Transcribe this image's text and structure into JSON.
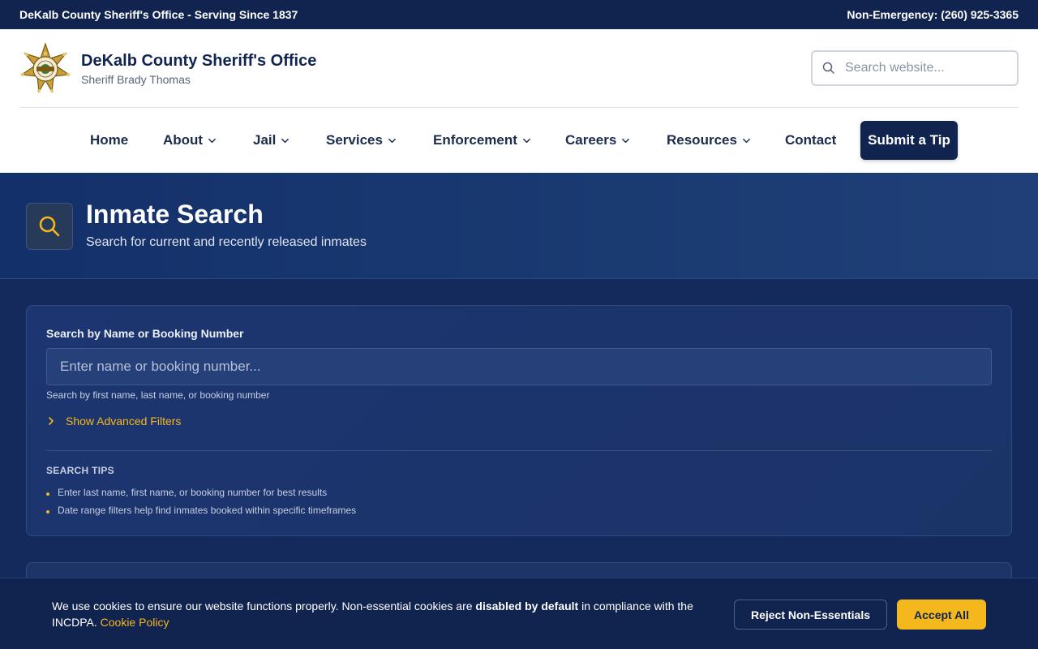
{
  "topbar": {
    "left_text": "DeKalb County Sheriff's Office - Serving Since 1837",
    "right_text": "Non-Emergency: (260) 925-3365"
  },
  "header": {
    "title": "DeKalb County Sheriff's Office",
    "subtitle": "Sheriff Brady Thomas",
    "badge_icon": "sheriff-star-badge",
    "search_placeholder": "Search website..."
  },
  "nav": {
    "items": [
      {
        "label": "Home",
        "dropdown": false
      },
      {
        "label": "About",
        "dropdown": true
      },
      {
        "label": "Jail",
        "dropdown": true
      },
      {
        "label": "Services",
        "dropdown": true
      },
      {
        "label": "Enforcement",
        "dropdown": true
      },
      {
        "label": "Careers",
        "dropdown": true
      },
      {
        "label": "Resources",
        "dropdown": true
      },
      {
        "label": "Contact",
        "dropdown": false
      }
    ],
    "cta_label": "Submit a Tip"
  },
  "hero": {
    "icon": "search-icon",
    "title": "Inmate Search",
    "subtitle": "Search for current and recently released inmates"
  },
  "search_card": {
    "label": "Search by Name or Booking Number",
    "input_placeholder": "Enter name or booking number...",
    "input_value": "",
    "help_text": "Search by first name, last name, or booking number",
    "advanced_label": "Show Advanced Filters",
    "tips_title": "SEARCH TIPS",
    "tips": [
      "Enter last name, first name, or booking number for best results",
      "Date range filters help find inmates booked within specific timeframes"
    ]
  },
  "cookie_banner": {
    "text_before": "We use cookies to ensure our website functions properly. Non-essential cookies are ",
    "text_bold": "disabled by default",
    "text_after": " in compliance with the INCDPA. ",
    "link_label": "Cookie Policy",
    "reject_label": "Reject Non-Essentials",
    "accept_label": "Accept All"
  },
  "colors": {
    "navy": "#10244f",
    "accent_gold": "#f5b81c",
    "page_bg": "#142a5c"
  }
}
